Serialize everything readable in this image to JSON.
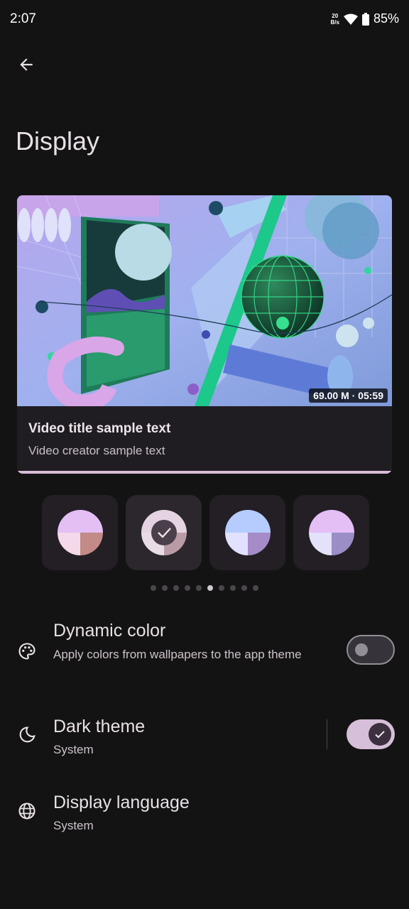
{
  "status_bar": {
    "time": "2:07",
    "speed_value": "20",
    "speed_unit": "B/s",
    "battery": "85%"
  },
  "header": {
    "title": "Display",
    "back_icon": "arrow-back-icon"
  },
  "preview": {
    "duration": "69.00 M · 05:59",
    "video_title": "Video title sample text",
    "video_creator": "Video creator sample text"
  },
  "swatches": [
    {
      "top": "#e4bff4",
      "left": "#f3d9ea",
      "right": "#c28b88",
      "selected": false
    },
    {
      "top": "#e5d3e1",
      "left": "#eadce6",
      "right": "#b99ba6",
      "selected": true
    },
    {
      "top": "#b6ccff",
      "left": "#e2e1ff",
      "right": "#a58cc8",
      "selected": false
    },
    {
      "top": "#e4bff6",
      "left": "#e4e1fb",
      "right": "#9b8ec6",
      "selected": false
    }
  ],
  "pager": {
    "count": 10,
    "active": 5
  },
  "settings": {
    "dynamic_color": {
      "title": "Dynamic color",
      "subtitle": "Apply colors from wallpapers to the app theme",
      "icon": "palette-icon",
      "enabled": false
    },
    "dark_theme": {
      "title": "Dark theme",
      "subtitle": "System",
      "icon": "moon-icon",
      "enabled": true
    },
    "display_language": {
      "title": "Display language",
      "subtitle": "System",
      "icon": "globe-icon"
    }
  }
}
